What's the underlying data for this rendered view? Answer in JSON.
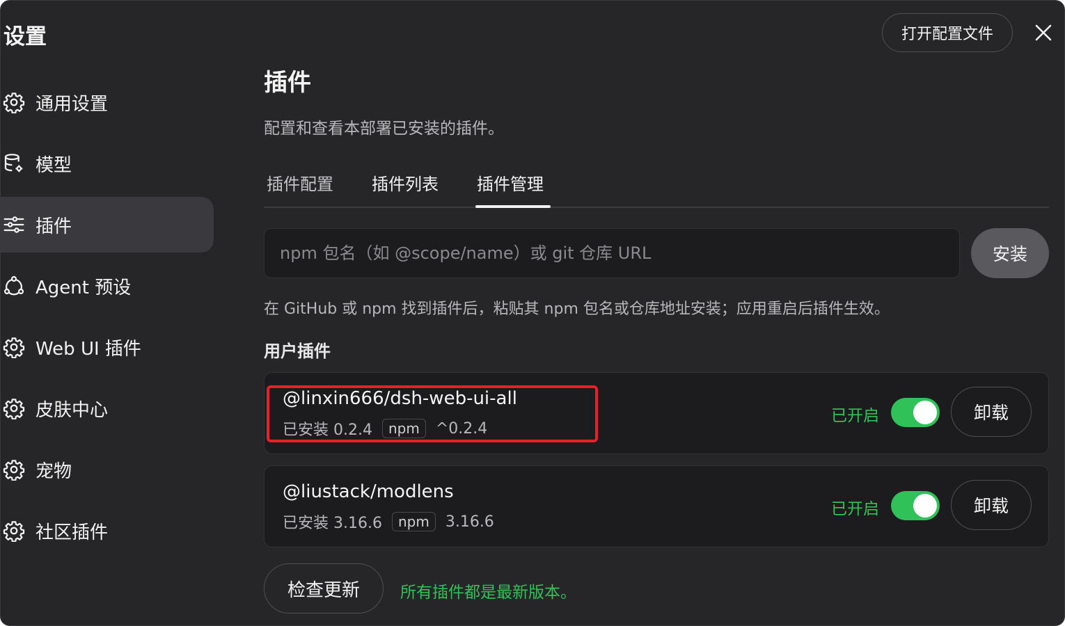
{
  "window": {
    "title": "设置",
    "open_config_label": "打开配置文件"
  },
  "sidebar": {
    "items": [
      {
        "label": "通用设置",
        "icon": "gear-icon"
      },
      {
        "label": "模型",
        "icon": "database-icon"
      },
      {
        "label": "插件",
        "icon": "sliders-icon",
        "active": true
      },
      {
        "label": "Agent 预设",
        "icon": "agent-nodes-icon"
      },
      {
        "label": "Web UI 插件",
        "icon": "gear-icon"
      },
      {
        "label": "皮肤中心",
        "icon": "gear-icon"
      },
      {
        "label": "宠物",
        "icon": "gear-icon"
      },
      {
        "label": "社区插件",
        "icon": "gear-icon"
      }
    ]
  },
  "main": {
    "title": "插件",
    "description": "配置和查看本部署已安装的插件。",
    "tabs": [
      {
        "label": "插件配置"
      },
      {
        "label": "插件列表"
      },
      {
        "label": "插件管理",
        "active": true
      }
    ],
    "install": {
      "placeholder": "npm 包名（如 @scope/name）或 git 仓库 URL",
      "value": "",
      "button_label": "安装",
      "hint": "在 GitHub 或 npm 找到插件后，粘贴其 npm 包名或仓库地址安装；应用重启后插件生效。"
    },
    "user_plugins": {
      "title": "用户插件",
      "items": [
        {
          "name": "@linxin666/dsh-web-ui-all",
          "installed": "已安装 0.2.4",
          "source": "npm",
          "version_spec": "^0.2.4",
          "status": "已开启",
          "enabled": true,
          "uninstall_label": "卸载",
          "highlighted": true
        },
        {
          "name": "@liustack/modlens",
          "installed": "已安装 3.16.6",
          "source": "npm",
          "version_spec": "3.16.6",
          "status": "已开启",
          "enabled": true,
          "uninstall_label": "卸载",
          "highlighted": false
        }
      ]
    },
    "check_update_label": "检查更新",
    "update_status": "所有插件都是最新版本。"
  },
  "colors": {
    "background": "#262628",
    "accent_green": "#30c158",
    "highlight_red": "#e8202a"
  }
}
